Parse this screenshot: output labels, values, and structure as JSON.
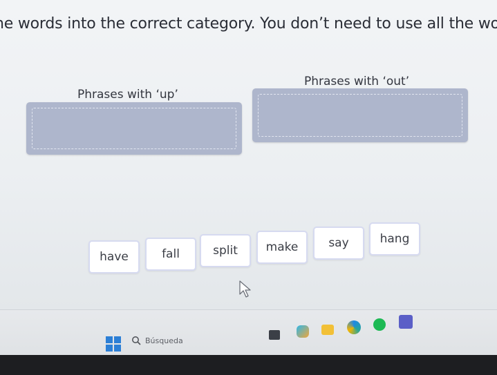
{
  "instruction": "ne words into the correct category. You don’t need to use all the wor",
  "categories": [
    {
      "label": "Phrases with ‘up’"
    },
    {
      "label": "Phrases with ‘out’"
    }
  ],
  "words": [
    "have",
    "fall",
    "split",
    "make",
    "say",
    "hang"
  ],
  "taskbar": {
    "search_placeholder": "Búsqueda",
    "icons": [
      "windows-start",
      "search",
      "file-explorer",
      "copilot",
      "folder",
      "browser",
      "spotify",
      "teams"
    ]
  },
  "colors": {
    "drop_zone": "#aeb6cc",
    "chip_border": "#d6daf0",
    "windows_blue": "#2c7fd6"
  }
}
